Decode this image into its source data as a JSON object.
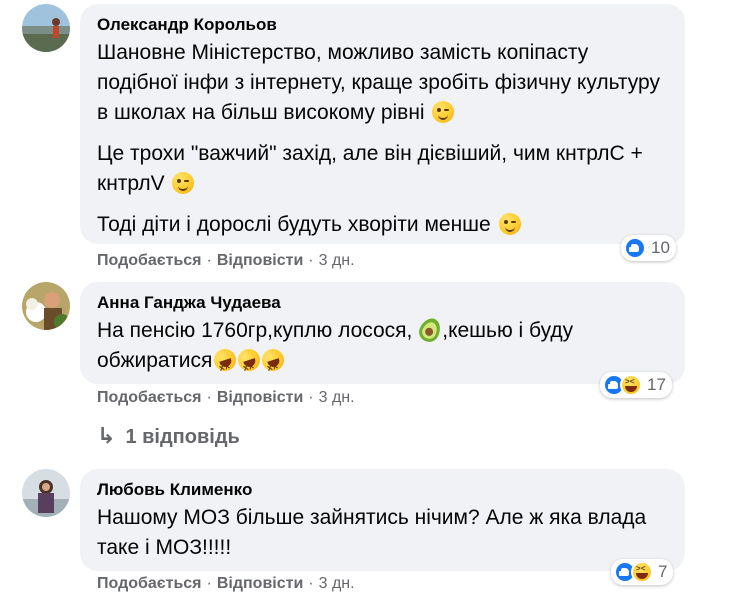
{
  "comments": [
    {
      "author": "Олександр Корольов",
      "paragraphs": [
        "Шановне Міністерство, можливо замість копіпасту подібної інфи з інтернету, краще зробіть фізичну культуру в школах на більш високому рівні",
        "Це трохи \"важчий\" захід, але він дієвіший, чим кнтрлС + кнтрлV",
        "Тоді діти і дорослі будуть хворіти менше"
      ],
      "like_label": "Подобається",
      "reply_label": "Відповісти",
      "time": "3 дн.",
      "reaction_count": "10",
      "reaction_icons": [
        "like-icon"
      ]
    },
    {
      "author": "Анна Ганджа Чудаева",
      "text_part1": "На пенсію 1760гр,куплю лосося,",
      "text_part2": ",кешью і буду обжиратися",
      "like_label": "Подобається",
      "reply_label": "Відповісти",
      "time": "3 дн.",
      "reaction_count": "17",
      "reaction_icons": [
        "like-icon",
        "haha-icon"
      ]
    },
    {
      "author": "Любовь Клименко",
      "text": "Нашому МОЗ більше зайнятись нічим? Але ж яка влада таке і МОЗ!!!!!",
      "like_label": "Подобається",
      "reply_label": "Відповісти",
      "time": "3 дн.",
      "reaction_count": "7",
      "reaction_icons": [
        "like-icon",
        "haha-icon"
      ]
    }
  ],
  "replies_link": "1 відповідь",
  "separator": "·",
  "colors": {
    "bubble": "#f0f2f5",
    "secondary_text": "#65676b",
    "like_blue": "#1877f2"
  }
}
